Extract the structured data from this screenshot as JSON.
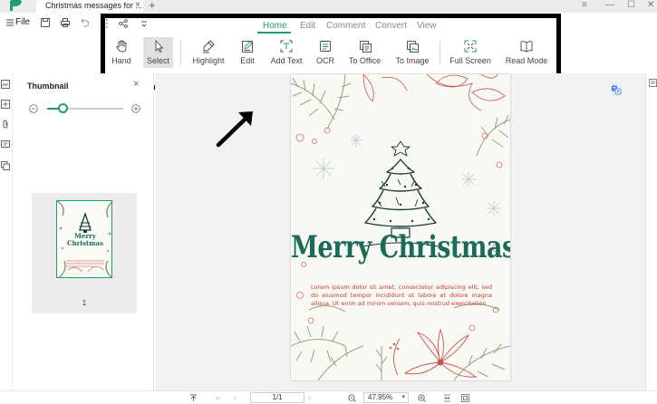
{
  "titlebar": {
    "tab_title": "Christmas messages for ...",
    "tab_close": "×",
    "new_tab": "+",
    "minimize": "—",
    "maximize": "☐",
    "close": "✕",
    "menu": "≡"
  },
  "quickbar": {
    "file_label": "File"
  },
  "ribbon": {
    "tabs": [
      "Home",
      "Edit",
      "Comment",
      "Convert",
      "View"
    ],
    "active_tab": "Home",
    "tools": [
      "Hand",
      "Select",
      "Highlight",
      "Edit",
      "Add Text",
      "OCR",
      "To Office",
      "To Image",
      "Full Screen",
      "Read Mode"
    ],
    "selected_tool": "Select"
  },
  "thumbnail_panel": {
    "title": "Thumbnail",
    "close": "×",
    "zoom_slider_value": 0.21,
    "page_number": "1"
  },
  "document": {
    "heading": "Merry Christmas",
    "body": "Lorem ipsum dolor sit amet, consectetur adipiscing elit, sed do eiusmod tempor incididunt ut labore et dolore magna aliqua. Ut enim ad minim veniam, quis nostrud exercitation",
    "thumb_heading_line1": "Merry",
    "thumb_heading_line2": "Christmas"
  },
  "statusbar": {
    "page_indicator": "1/1",
    "zoom_level": "47.95%"
  },
  "colors": {
    "accent": "#1e9c72",
    "heading_green": "#1b6b5a",
    "body_red": "#c4393a",
    "annotation_box": "#000000"
  },
  "icons": [
    "app-logo-icon",
    "save-icon",
    "print-icon",
    "undo-icon",
    "share-icon",
    "customize-icon",
    "hand-icon",
    "cursor-icon",
    "highlighter-icon",
    "edit-icon",
    "add-text-icon",
    "ocr-icon",
    "to-office-icon",
    "to-image-icon",
    "full-screen-icon",
    "read-mode-icon",
    "translate-icon",
    "arrow-icon"
  ]
}
